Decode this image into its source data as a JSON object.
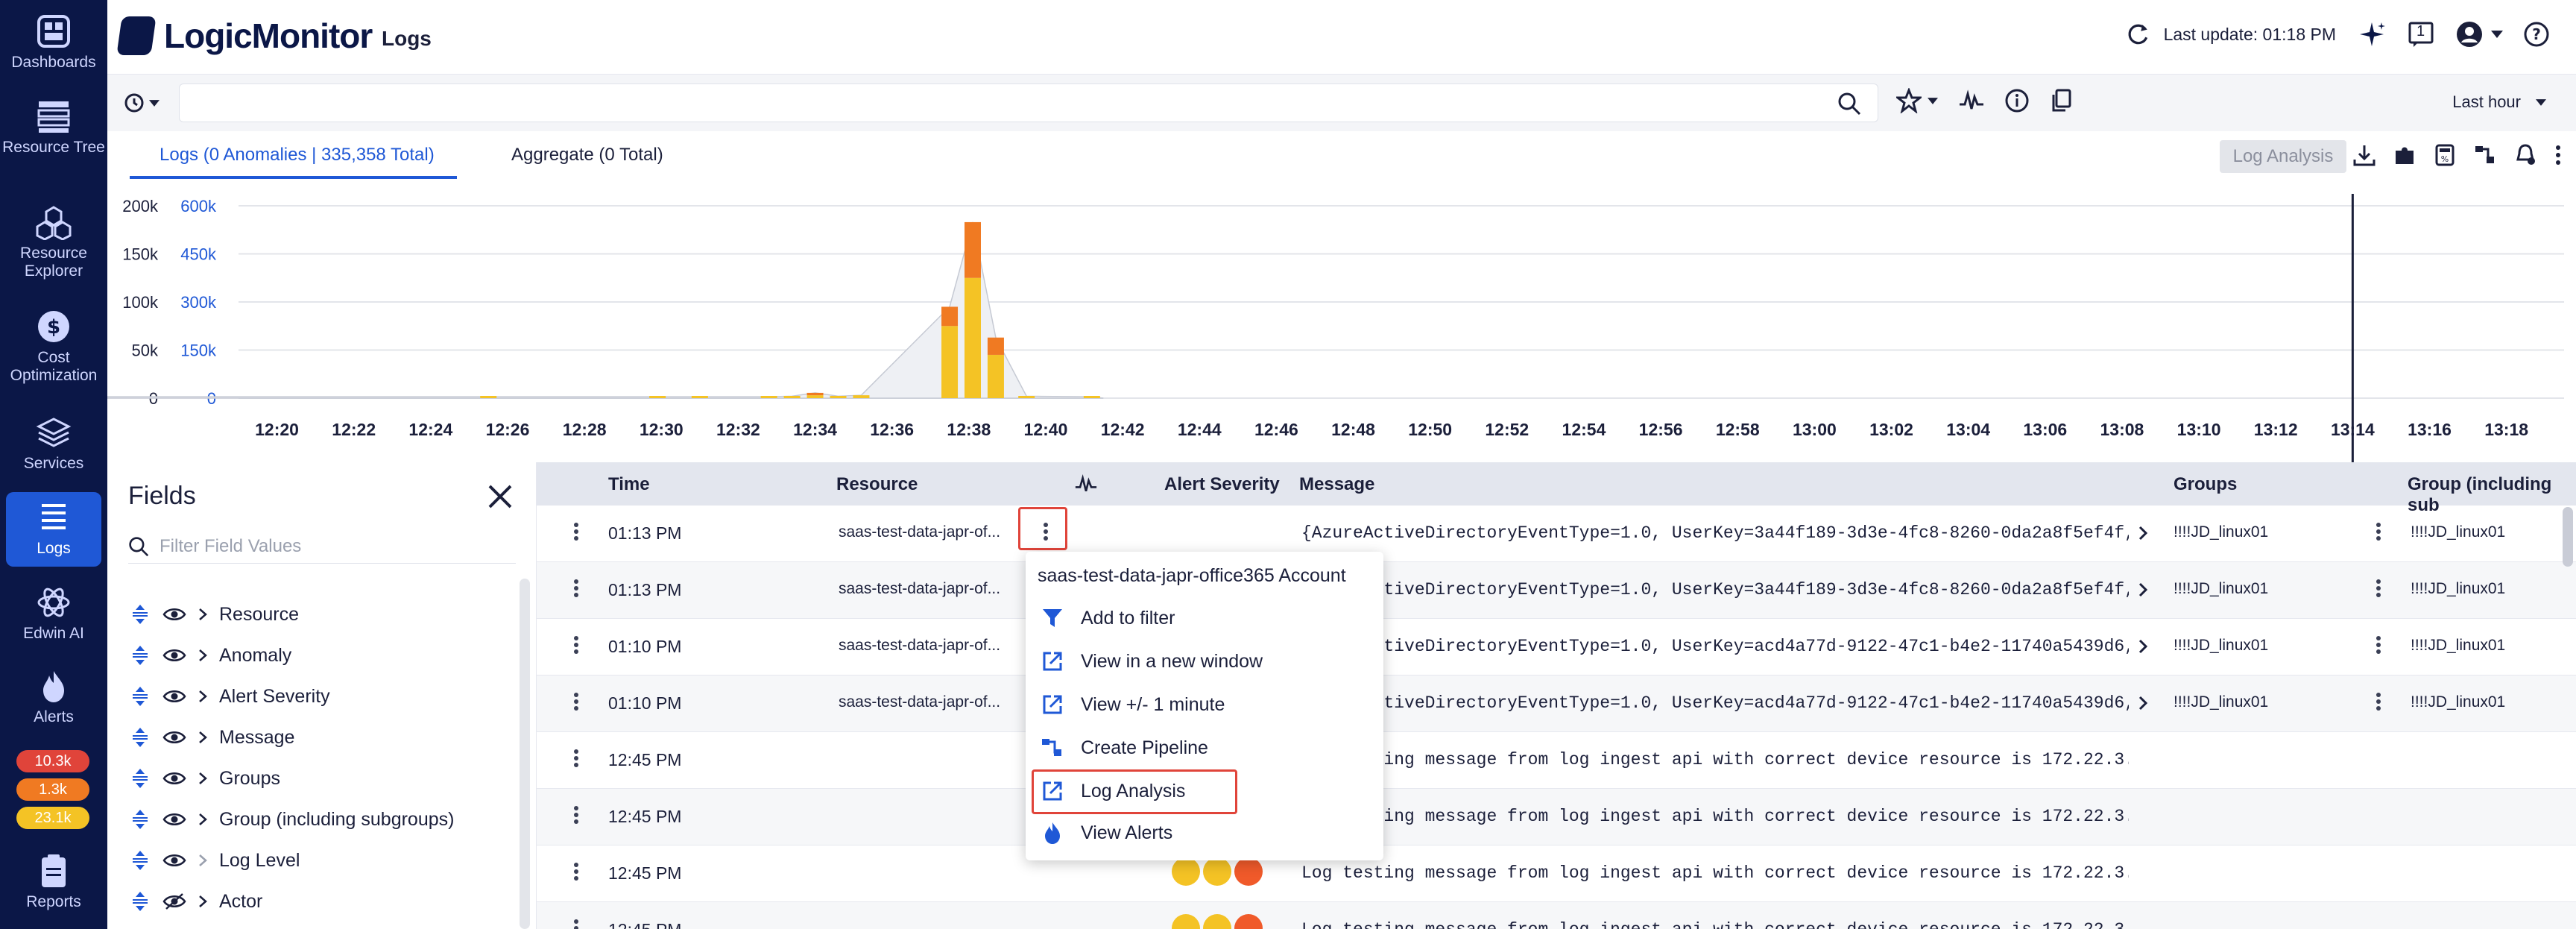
{
  "nav": {
    "items": [
      {
        "label": "Dashboards",
        "icon": "dashboards-icon"
      },
      {
        "label": "Resource Tree",
        "icon": "resource-tree-icon"
      },
      {
        "label": "Resource Explorer",
        "icon": "resource-explorer-icon"
      },
      {
        "label": "Cost Optimization",
        "icon": "cost-optimization-icon"
      },
      {
        "label": "Services",
        "icon": "services-icon"
      },
      {
        "label": "Logs",
        "icon": "logs-icon",
        "active": true
      },
      {
        "label": "Edwin AI",
        "icon": "edwin-ai-icon"
      },
      {
        "label": "Alerts",
        "icon": "alerts-icon"
      },
      {
        "label": "Reports",
        "icon": "reports-icon"
      }
    ],
    "alert_badges": [
      {
        "label": "10.3k",
        "color": "#e0443a"
      },
      {
        "label": "1.3k",
        "color": "#f07a22"
      },
      {
        "label": "23.1k",
        "color": "#f4c325"
      }
    ]
  },
  "header": {
    "brand": "LogicMonitor",
    "page_title": "Logs",
    "last_update": "Last update: 01:18 PM",
    "notification_count": "1"
  },
  "search": {
    "query": "",
    "time_range": "Last hour"
  },
  "tabs": [
    {
      "label": "Logs (0 Anomalies | 335,358 Total)",
      "active": true
    },
    {
      "label": "Aggregate (0 Total)",
      "active": false
    }
  ],
  "log_analysis_button": "Log Analysis",
  "chart_data": {
    "type": "bar",
    "left_axis_ticks": [
      "200k",
      "150k",
      "100k",
      "50k",
      "0"
    ],
    "right_axis_ticks": [
      "600k",
      "450k",
      "300k",
      "150k",
      "0"
    ],
    "left_axis_values": [
      200000,
      150000,
      100000,
      50000,
      0
    ],
    "right_axis_values": [
      600000,
      450000,
      300000,
      150000,
      0
    ],
    "x_ticks": [
      "12:20",
      "12:22",
      "12:24",
      "12:26",
      "12:28",
      "12:30",
      "12:32",
      "12:34",
      "12:36",
      "12:38",
      "12:40",
      "12:42",
      "12:44",
      "12:46",
      "12:48",
      "12:50",
      "12:52",
      "12:54",
      "12:56",
      "12:58",
      "13:00",
      "13:02",
      "13:04",
      "13:06",
      "13:08",
      "13:10",
      "13:12",
      "13:14",
      "13:16",
      "13:18"
    ],
    "series": [
      {
        "color": "#f4c325",
        "points": [
          [
            12.3,
            1500
          ],
          [
            12.6,
            1500
          ],
          [
            25.5,
            1500
          ],
          [
            29.9,
            1500
          ],
          [
            31.0,
            1500
          ],
          [
            32.8,
            1500
          ],
          [
            33.4,
            2000
          ],
          [
            34.0,
            3000
          ],
          [
            34.6,
            2000
          ],
          [
            35.2,
            3000
          ],
          [
            37.5,
            75000
          ],
          [
            38.1,
            125000
          ],
          [
            38.7,
            45000
          ],
          [
            39.5,
            2000
          ],
          [
            41.2,
            1500
          ]
        ]
      },
      {
        "color": "#f07a22",
        "points": [
          [
            34.0,
            2500
          ],
          [
            37.5,
            20000
          ],
          [
            38.1,
            58000
          ],
          [
            38.7,
            18000
          ]
        ]
      }
    ],
    "cursor_x": "13:14",
    "ylim": [
      0,
      200000
    ]
  },
  "fields": {
    "title": "Fields",
    "filter_placeholder": "Filter Field Values",
    "items": [
      {
        "label": "Resource",
        "visible": true,
        "expandable": true
      },
      {
        "label": "Anomaly",
        "visible": true,
        "expandable": true
      },
      {
        "label": "Alert Severity",
        "visible": true,
        "expandable": true
      },
      {
        "label": "Message",
        "visible": true,
        "expandable": true
      },
      {
        "label": "Groups",
        "visible": true,
        "expandable": true
      },
      {
        "label": "Group (including subgroups)",
        "visible": true,
        "expandable": true
      },
      {
        "label": "Log Level",
        "visible": true,
        "expandable": false
      },
      {
        "label": "Actor",
        "visible": false,
        "expandable": true
      }
    ]
  },
  "table": {
    "columns": [
      "Time",
      "Resource",
      "Alert Severity",
      "Message",
      "Groups",
      "Group (including sub"
    ],
    "rows": [
      {
        "time": "01:13 PM",
        "resource": "saas-test-data-japr-of...",
        "message": "{AzureActiveDirectoryEventType=1.0, UserKey=3a44f189-3d3e-4fc8-8260-0da2a8f5ef4f, A...",
        "groups": "!!!!JD_linux01",
        "group_sub": "!!!!JD_linux01"
      },
      {
        "time": "01:13 PM",
        "resource": "saas-test-data-japr-of...",
        "message": "{AzureActiveDirectoryEventType=1.0, UserKey=3a44f189-3d3e-4fc8-8260-0da2a8f5ef4f, A...",
        "groups": "!!!!JD_linux01",
        "group_sub": "!!!!JD_linux01"
      },
      {
        "time": "01:10 PM",
        "resource": "saas-test-data-japr-of...",
        "message": "{AzureActiveDirectoryEventType=1.0, UserKey=acd4a77d-9122-47c1-b4e2-11740a5439d6, A...",
        "groups": "!!!!JD_linux01",
        "group_sub": "!!!!JD_linux01"
      },
      {
        "time": "01:10 PM",
        "resource": "saas-test-data-japr-of...",
        "message": "{AzureActiveDirectoryEventType=1.0, UserKey=acd4a77d-9122-47c1-b4e2-11740a5439d6, A...",
        "groups": "!!!!JD_linux01",
        "group_sub": "!!!!JD_linux01"
      },
      {
        "time": "12:45 PM",
        "resource": "",
        "message": "Log testing message from log ingest api with correct device resource is 172.22.3.5.",
        "groups": "",
        "group_sub": ""
      },
      {
        "time": "12:45 PM",
        "resource": "",
        "message": "Log testing message from log ingest api with correct device resource is 172.22.3.5.",
        "groups": "",
        "group_sub": ""
      },
      {
        "time": "12:45 PM",
        "resource": "",
        "message": "Log testing message from log ingest api with correct device resource is 172.22.3.5.",
        "groups": "",
        "group_sub": ""
      },
      {
        "time": "12:45 PM",
        "resource": "",
        "message": "Log testing message from log ingest api with correct device resource is 172.22.3.5.",
        "groups": "",
        "group_sub": ""
      }
    ]
  },
  "context_menu": {
    "title": "saas-test-data-japr-office365 Account",
    "items": [
      {
        "label": "Add to filter",
        "icon": "filter-icon"
      },
      {
        "label": "View in a new window",
        "icon": "external-link-icon"
      },
      {
        "label": "View +/- 1 minute",
        "icon": "external-link-icon"
      },
      {
        "label": "Create Pipeline",
        "icon": "pipeline-icon"
      },
      {
        "label": "Log Analysis",
        "icon": "external-link-icon",
        "highlighted": true
      },
      {
        "label": "View Alerts",
        "icon": "alert-flame-icon"
      }
    ]
  }
}
